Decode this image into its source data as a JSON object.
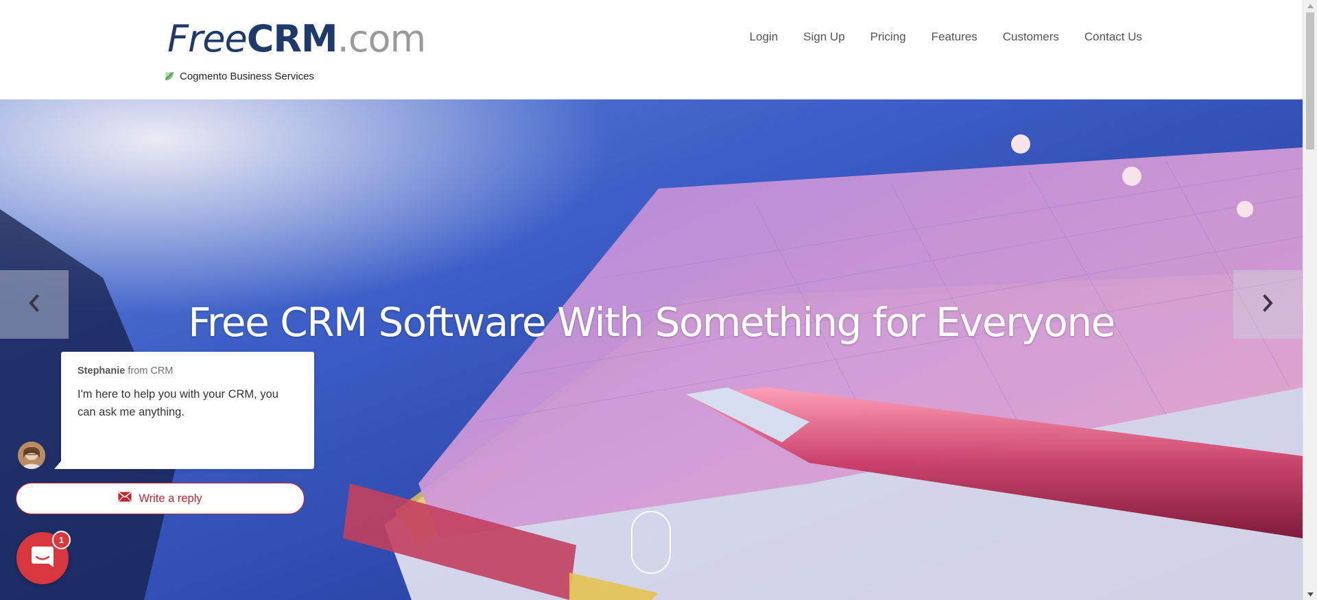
{
  "brand": {
    "logo_free": "Free",
    "logo_crm": "CRM",
    "logo_domain": ".com",
    "tagline": "Cogmento Business Services",
    "tagline_icon": "leaf-icon"
  },
  "nav": {
    "items": [
      {
        "label": "Login"
      },
      {
        "label": "Sign Up"
      },
      {
        "label": "Pricing"
      },
      {
        "label": "Features"
      },
      {
        "label": "Customers"
      },
      {
        "label": "Contact Us"
      }
    ]
  },
  "hero": {
    "title": "Free CRM Software With Something for Everyone",
    "prev_icon": "chevron-left-icon",
    "next_icon": "chevron-right-icon",
    "scroll_icon": "mouse-scroll-icon"
  },
  "chat": {
    "sender_name": "Stephanie",
    "sender_org": "from CRM",
    "message": "I'm here to help you with your CRM, you can ask me anything.",
    "reply_label": "Write a reply",
    "reply_icon": "envelope-icon",
    "launcher_icon": "chat-bubble-icon",
    "unread_count": "1"
  },
  "colors": {
    "brand_navy": "#1d3a6b",
    "accent_red": "#c4242e",
    "launcher_red": "#d8373d"
  }
}
